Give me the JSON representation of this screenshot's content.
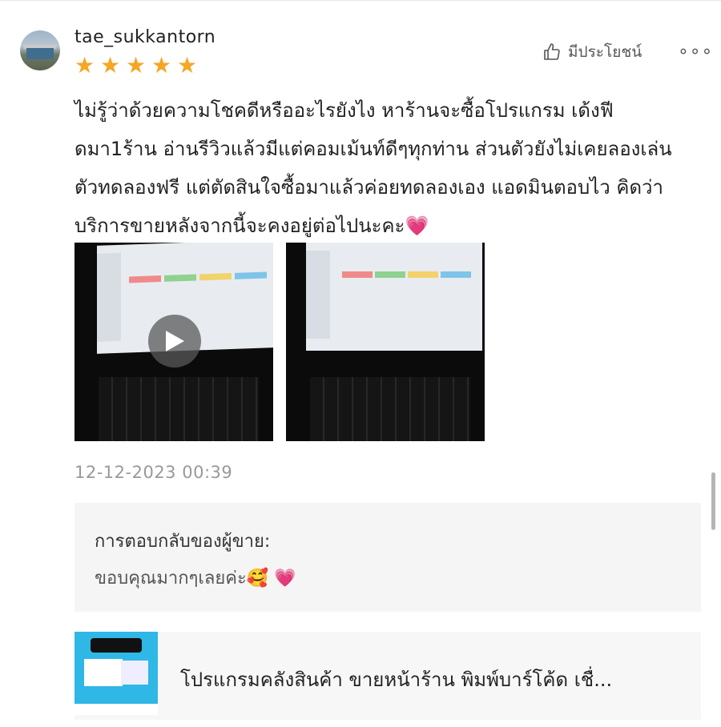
{
  "review": {
    "username": "tae_sukkantorn",
    "rating": 5,
    "stars": [
      "★",
      "★",
      "★",
      "★",
      "★"
    ],
    "helpful_label": "มีประโยชน์",
    "more_label": "∘∘∘",
    "text": "ไม่รู้ว่าด้วยความโชคดีหรืออะไรยังไง หาร้านจะซื้อโปรแกรม เด้งฟีดมา1ร้าน อ่านรีวิวแล้วมีแต่คอมเม้นท์ดีๆทุกท่าน ส่วนตัวยังไม่เคยลองเล่นตัวทดลองฟรี แต่ตัดสินใจซื้อมาแล้วค่อยทดลองเอง แอดมินตอบไว คิดว่าบริการขายหลังจากนี้จะคงอยู่ต่อไปนะคะ💗",
    "timestamp": "12-12-2023 00:39"
  },
  "seller_reply": {
    "title": "การตอบกลับของผู้ขาย:",
    "text": "ขอบคุณมากๆเลยค่ะ🥰 💗"
  },
  "product": {
    "title": "โปรแกรมคลังสินค้า ขายหน้าร้าน พิมพ์บาร์โค้ด เชื่..."
  },
  "colors": {
    "star": "#f5a623",
    "muted_text": "#999999",
    "reply_bg": "#f5f5f5"
  }
}
